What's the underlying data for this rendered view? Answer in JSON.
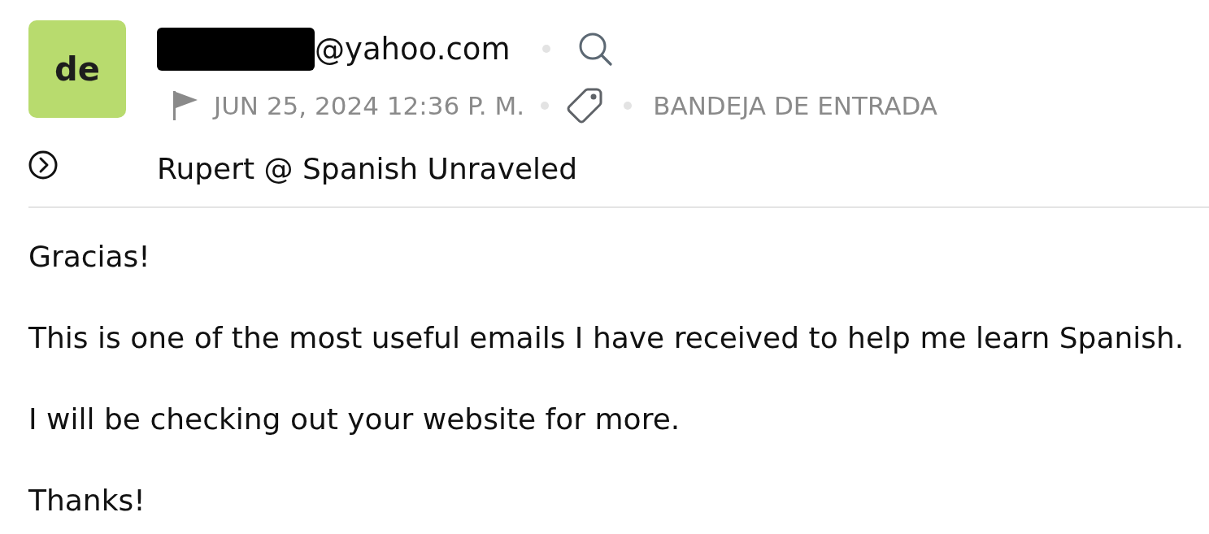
{
  "avatar": {
    "initials": "de"
  },
  "sender": {
    "redacted": true,
    "address": "@yahoo.com"
  },
  "meta": {
    "date": "JUN 25, 2024 12:36 P. M.",
    "folder": "BANDEJA DE ENTRADA"
  },
  "subject": "Rupert @ Spanish Unraveled",
  "body": [
    "Gracias!",
    "This is one of the most useful emails I have received to help me learn Spanish.",
    "I will be checking out your website for more.",
    "Thanks!"
  ]
}
